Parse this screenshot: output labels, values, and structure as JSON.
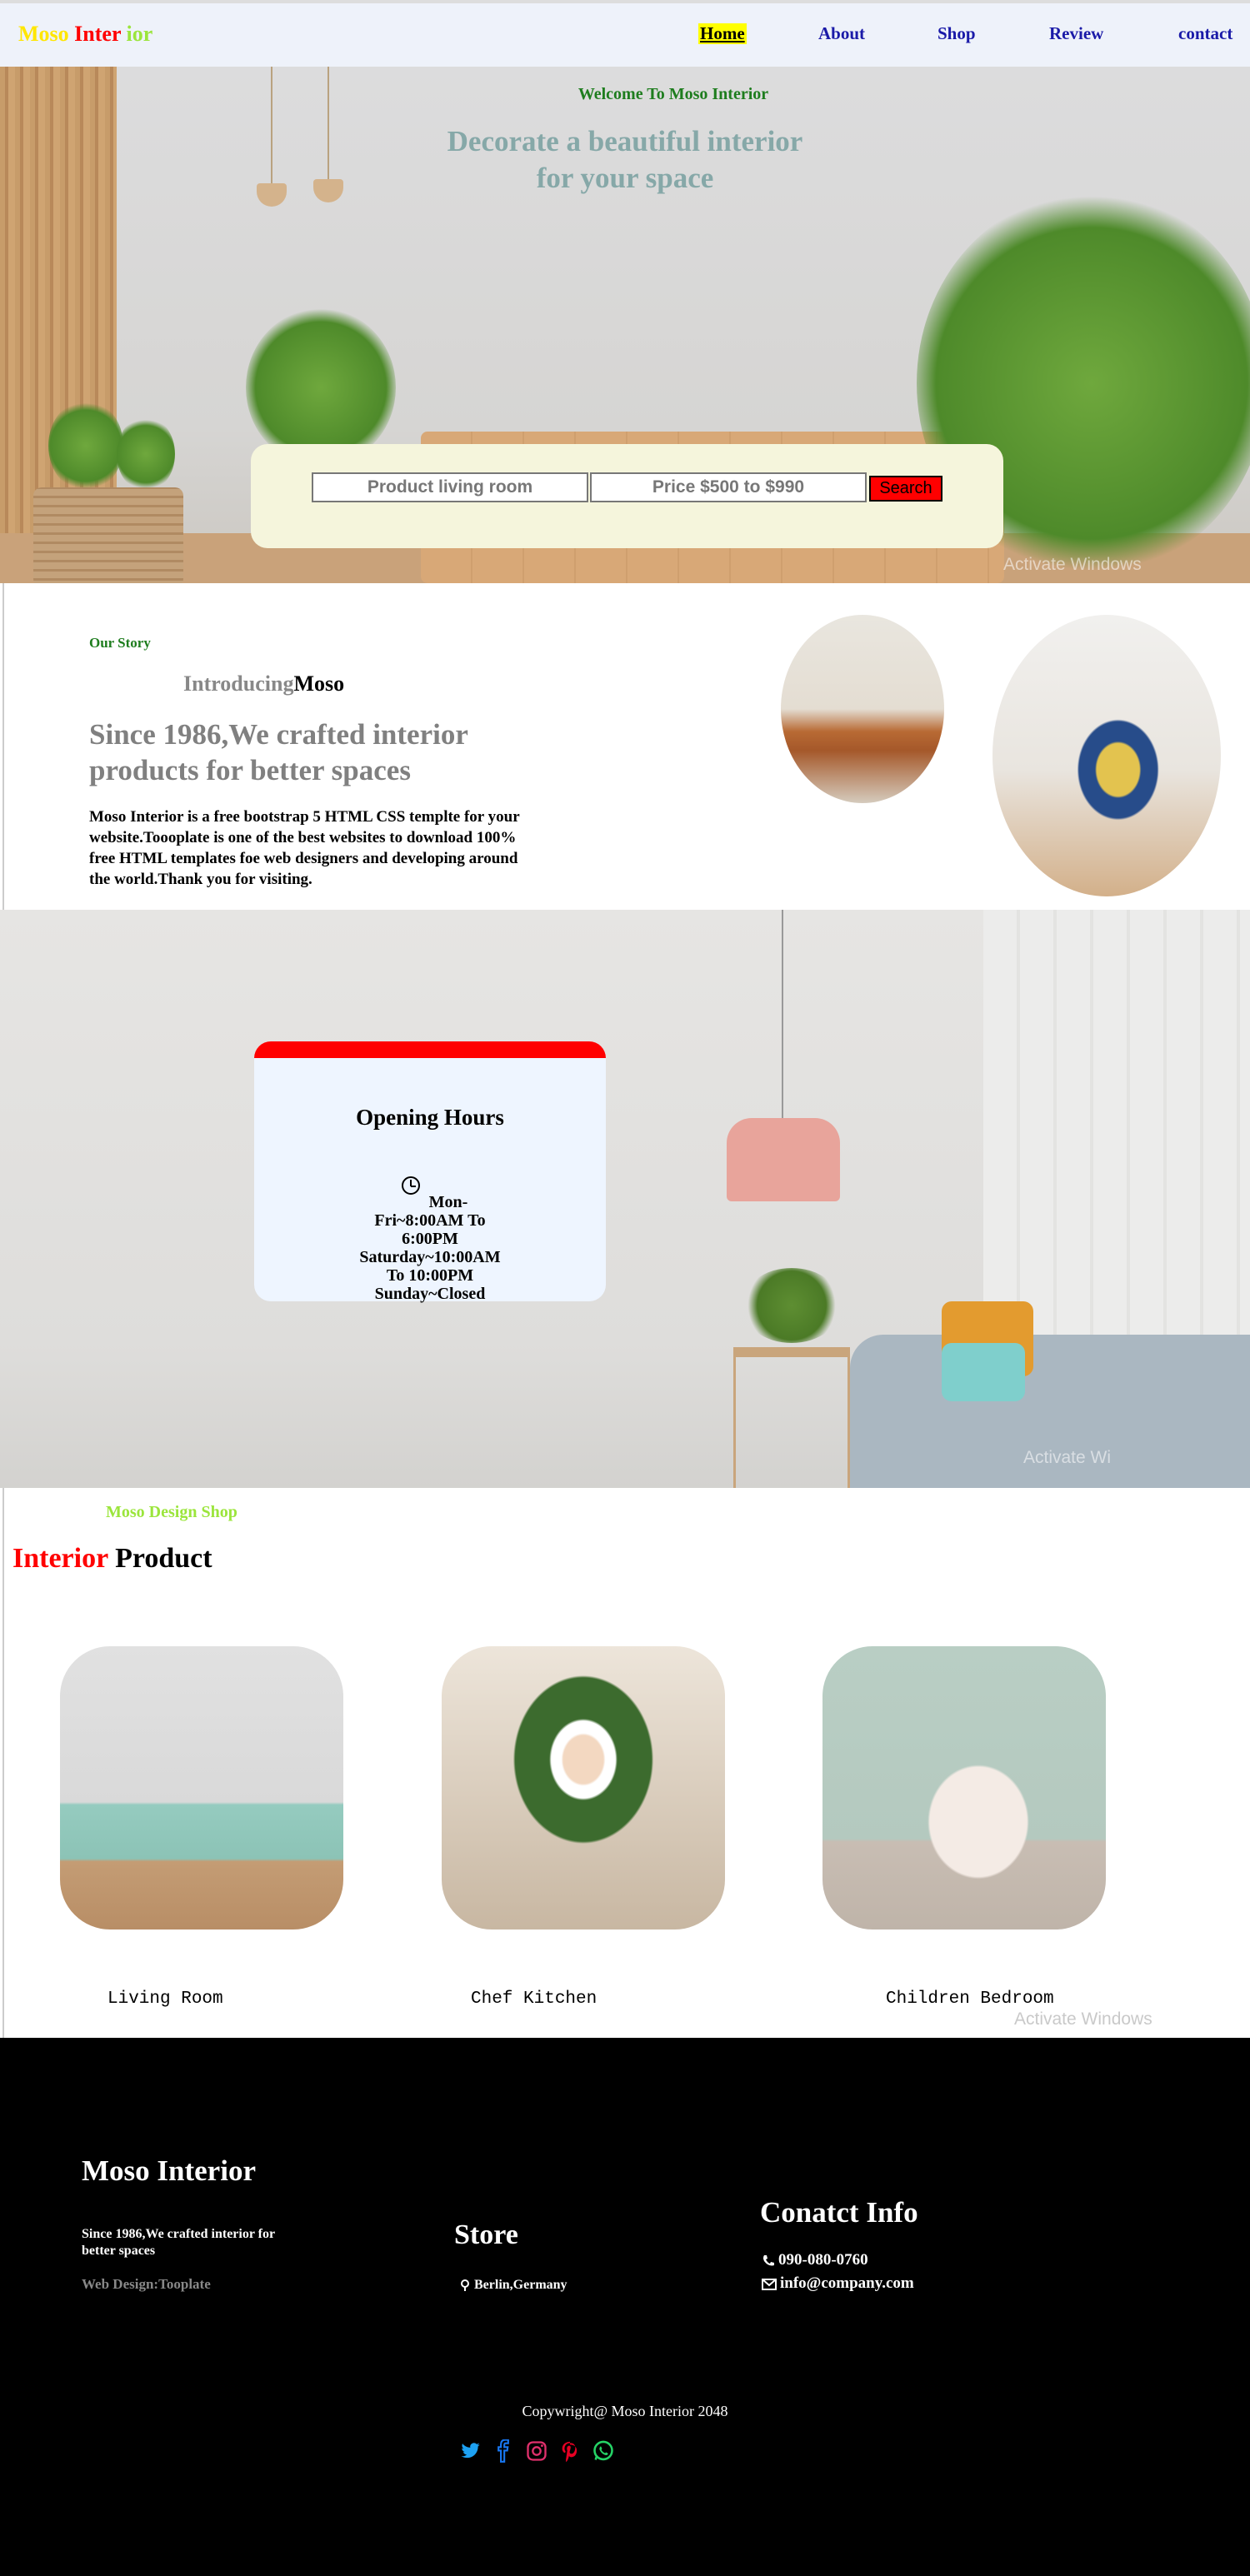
{
  "nav": {
    "logo": {
      "part1": "Moso ",
      "part2": "Inter",
      "part3": " ior"
    },
    "links": {
      "home": "Home",
      "about": "About",
      "shop": "Shop",
      "review": "Review",
      "contact": "contact"
    }
  },
  "hero": {
    "welcome": "Welcome To Moso Interior",
    "headline_line1": "Decorate a beautiful interior",
    "headline_line2": "for your space",
    "search": {
      "product_value": "Product living room",
      "price_value": "Price $500 to $990",
      "button_label": "Search"
    },
    "watermark": "Activate Windows"
  },
  "story": {
    "eyebrow": "Our Story",
    "intro_a": "Introducing",
    "intro_b": "Moso",
    "title": "Since 1986,We crafted interior products for better spaces",
    "paragraph": "Moso Interior is a free bootstrap 5 HTML CSS templte for your website.Toooplate is one of the best websites to download 100% free HTML templates foe web designers and developing around the world.Thank you for visiting."
  },
  "hours": {
    "title": "Opening Hours",
    "lines": [
      "Mon-",
      "Fri~8:00AM To",
      "6:00PM",
      "Saturday~10:00AM",
      "To 10:00PM",
      "Sunday~Closed"
    ],
    "watermark": "Activate Wi"
  },
  "products": {
    "eyebrow": "Moso Design Shop",
    "title_a": "Interior",
    "title_b": " Product",
    "items": [
      {
        "name": "Living Room"
      },
      {
        "name": "Chef Kitchen"
      },
      {
        "name": "Children Bedroom"
      }
    ],
    "watermark": "Activate Windows"
  },
  "footer": {
    "brand": "Moso Interior",
    "description": "Since 1986,We crafted interior for better spaces",
    "credit": "Web Design:Tooplate",
    "store_title": "Store",
    "address": "Berlin,Germany",
    "contact_title": "Conatct Info",
    "phone": "090-080-0760",
    "email": "info@company.com",
    "copyright": "Copywright@ Moso Interior 2048",
    "social": [
      "twitter-icon",
      "facebook-icon",
      "instagram-icon",
      "pinterest-icon",
      "whatsapp-icon"
    ]
  },
  "colors": {
    "nav_bg": "#eef2fa",
    "link": "#1a1aa8",
    "accent_red": "#ff0000",
    "accent_green": "#1e7d1e",
    "accent_lime": "#9be53c",
    "accent_yellow": "#ffe600",
    "search_box": "#f5f5dc",
    "card_bg": "#eef5ff"
  }
}
